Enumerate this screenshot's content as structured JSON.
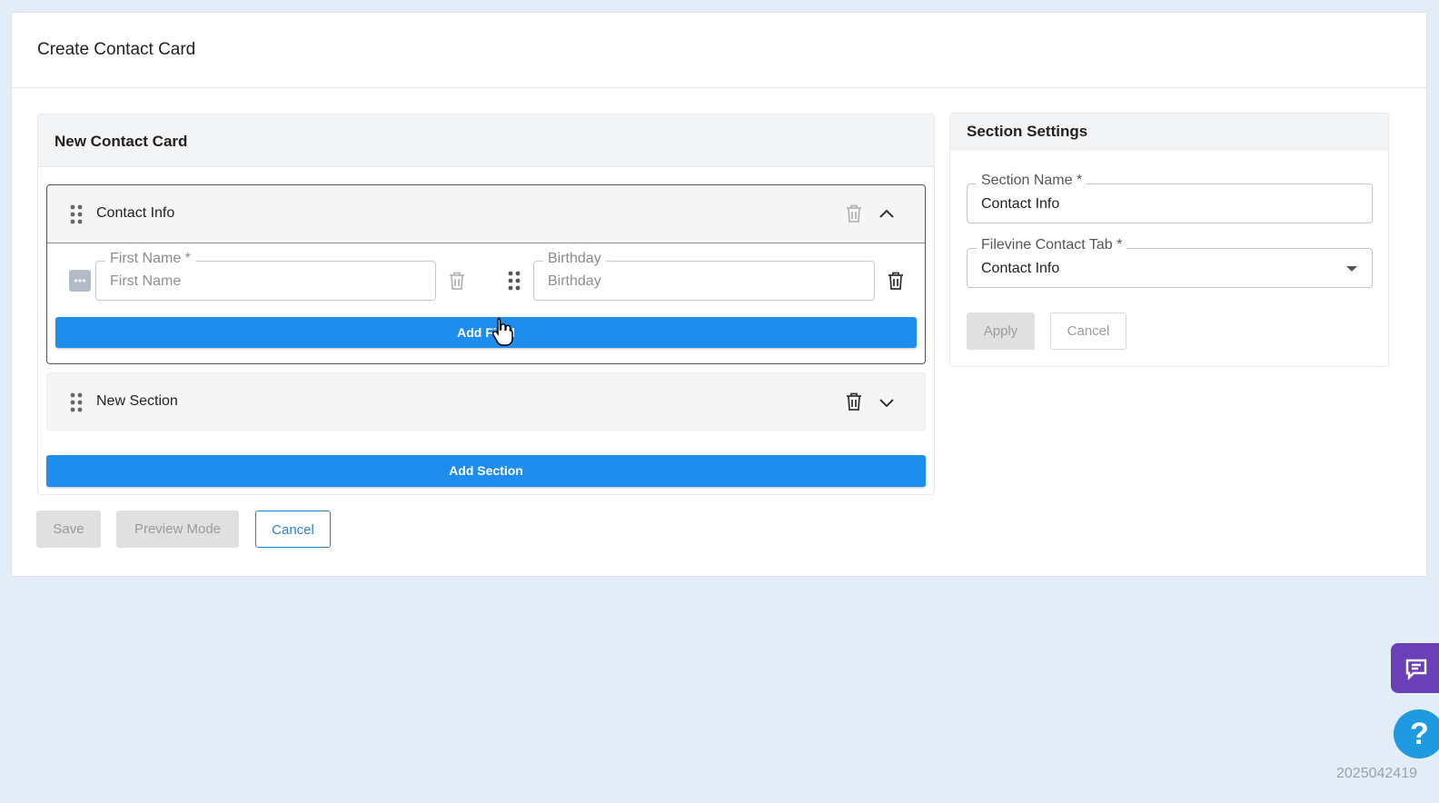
{
  "page": {
    "title": "Create Contact Card"
  },
  "builder": {
    "card_title": "New Contact Card",
    "sections": [
      {
        "name": "Contact Info",
        "expanded": true,
        "fields": [
          {
            "label": "First Name *",
            "placeholder": "First Name",
            "icon": "text-field-icon"
          },
          {
            "label": "Birthday",
            "placeholder": "Birthday",
            "icon": "drag-handle-icon"
          }
        ],
        "add_field_label": "Add Field"
      },
      {
        "name": "New Section",
        "expanded": false
      }
    ],
    "add_section_label": "Add Section"
  },
  "footer": {
    "save_label": "Save",
    "preview_label": "Preview Mode",
    "cancel_label": "Cancel"
  },
  "settings": {
    "title": "Section Settings",
    "section_name_label": "Section Name *",
    "section_name_value": "Contact Info",
    "tab_label": "Filevine Contact Tab *",
    "tab_value": "Contact Info",
    "apply_label": "Apply",
    "cancel_label": "Cancel"
  },
  "widgets": {
    "help_glyph": "?",
    "version": "2025042419"
  },
  "colors": {
    "primary": "#1f8ded",
    "chat": "#6a3fb8",
    "help": "#1e9be0",
    "background": "#e3edf7"
  }
}
